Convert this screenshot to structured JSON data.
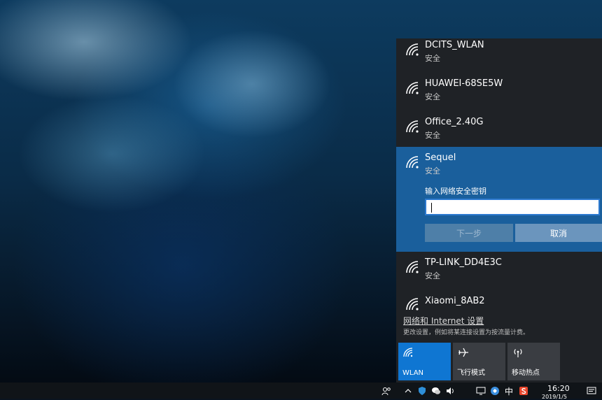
{
  "wifi_panel": {
    "networks_top": [
      {
        "name": "DCITS_WLAN",
        "status": "安全"
      },
      {
        "name": "HUAWEI-68SE5W",
        "status": "安全"
      },
      {
        "name": "Office_2.40G",
        "status": "安全"
      }
    ],
    "selected_network": {
      "name": "Sequel",
      "status": "安全",
      "key_label": "输入网络安全密钥",
      "key_value": "",
      "next_label": "下一步",
      "cancel_label": "取消"
    },
    "networks_bottom": [
      {
        "name": "TP-LINK_DD4E3C",
        "status": "安全"
      },
      {
        "name": "Xiaomi_8AB2",
        "status": ""
      }
    ],
    "settings_link": "网络和 Internet 设置",
    "settings_desc": "更改设置，例如将某连接设置为按流量计费。"
  },
  "quick_actions": [
    {
      "label": "WLAN",
      "icon": "wifi-icon",
      "active": true
    },
    {
      "label": "飞行模式",
      "icon": "airplane-icon",
      "active": false
    },
    {
      "label": "移动热点",
      "icon": "hotspot-icon",
      "active": false
    }
  ],
  "taskbar": {
    "ime_label": "中",
    "time": "16:20",
    "date": "2019/1/5"
  },
  "colors": {
    "panel_bg": "#1f2226",
    "selected_bg": "#1a5f9c",
    "accent": "#0f76d2"
  }
}
